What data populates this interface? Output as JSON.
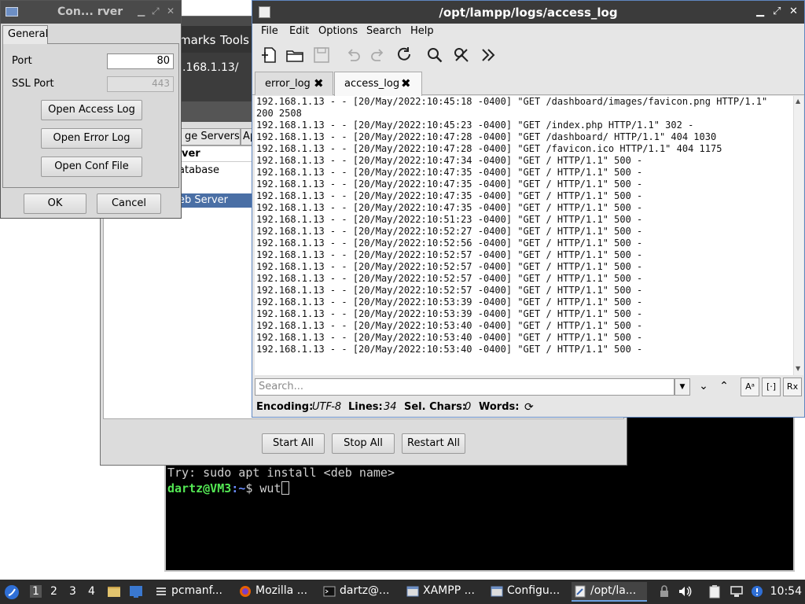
{
  "terminal": {
    "try_line": "Try: sudo apt install <deb name>",
    "prompt_user": "dartz@VM3",
    "prompt_path": ":~",
    "prompt_symbol": "$ ",
    "command": "wut"
  },
  "xampp": {
    "menu": [
      "marks",
      "Tools"
    ],
    "ip_fragment": ".168.1.13/",
    "tabs": [
      "ge Servers",
      "Ap"
    ],
    "list_header": "ver",
    "rows": [
      "atabase",
      "eb Server"
    ],
    "buttons": {
      "start_all": "Start All",
      "stop_all": "Stop All",
      "restart_all": "Restart All"
    }
  },
  "config_dialog": {
    "title": "Con... rver",
    "tab": "General",
    "port_label": "Port",
    "port_value": "80",
    "ssl_port_label": "SSL Port",
    "ssl_port_value": "443",
    "open_access_log": "Open Access Log",
    "open_error_log": "Open Error Log",
    "open_conf_file": "Open Conf File",
    "ok": "OK",
    "cancel": "Cancel"
  },
  "editor": {
    "title": "/opt/lampp/logs/access_log",
    "menu": [
      "File",
      "Edit",
      "Options",
      "Search",
      "Help"
    ],
    "tabs": [
      {
        "label": "error_log",
        "active": false
      },
      {
        "label": "access_log",
        "active": true
      }
    ],
    "lines": [
      "192.168.1.13 - - [20/May/2022:10:45:18 -0400] \"GET /dashboard/images/favicon.png HTTP/1.1\"",
      "200 2508",
      "192.168.1.13 - - [20/May/2022:10:45:23 -0400] \"GET /index.php HTTP/1.1\" 302 -",
      "192.168.1.13 - - [20/May/2022:10:47:28 -0400] \"GET /dashboard/ HTTP/1.1\" 404 1030",
      "192.168.1.13 - - [20/May/2022:10:47:28 -0400] \"GET /favicon.ico HTTP/1.1\" 404 1175",
      "192.168.1.13 - - [20/May/2022:10:47:34 -0400] \"GET / HTTP/1.1\" 500 -",
      "192.168.1.13 - - [20/May/2022:10:47:35 -0400] \"GET / HTTP/1.1\" 500 -",
      "192.168.1.13 - - [20/May/2022:10:47:35 -0400] \"GET / HTTP/1.1\" 500 -",
      "192.168.1.13 - - [20/May/2022:10:47:35 -0400] \"GET / HTTP/1.1\" 500 -",
      "192.168.1.13 - - [20/May/2022:10:47:35 -0400] \"GET / HTTP/1.1\" 500 -",
      "192.168.1.13 - - [20/May/2022:10:51:23 -0400] \"GET / HTTP/1.1\" 500 -",
      "192.168.1.13 - - [20/May/2022:10:52:27 -0400] \"GET / HTTP/1.1\" 500 -",
      "192.168.1.13 - - [20/May/2022:10:52:56 -0400] \"GET / HTTP/1.1\" 500 -",
      "192.168.1.13 - - [20/May/2022:10:52:57 -0400] \"GET / HTTP/1.1\" 500 -",
      "192.168.1.13 - - [20/May/2022:10:52:57 -0400] \"GET / HTTP/1.1\" 500 -",
      "192.168.1.13 - - [20/May/2022:10:52:57 -0400] \"GET / HTTP/1.1\" 500 -",
      "192.168.1.13 - - [20/May/2022:10:52:57 -0400] \"GET / HTTP/1.1\" 500 -",
      "192.168.1.13 - - [20/May/2022:10:53:39 -0400] \"GET / HTTP/1.1\" 500 -",
      "192.168.1.13 - - [20/May/2022:10:53:39 -0400] \"GET / HTTP/1.1\" 500 -",
      "192.168.1.13 - - [20/May/2022:10:53:40 -0400] \"GET / HTTP/1.1\" 500 -",
      "192.168.1.13 - - [20/May/2022:10:53:40 -0400] \"GET / HTTP/1.1\" 500 -",
      "192.168.1.13 - - [20/May/2022:10:53:40 -0400] \"GET / HTTP/1.1\" 500 -"
    ],
    "search_placeholder": "Search...",
    "status": {
      "encoding_label": "Encoding:",
      "encoding_value": "UTF-8",
      "lines_label": "Lines:",
      "lines_value": "34",
      "sel_label": "Sel. Chars:",
      "sel_value": "0",
      "words_label": "Words:"
    }
  },
  "taskbar": {
    "workspaces": [
      "1",
      "2",
      "3",
      "4"
    ],
    "tasks": [
      {
        "label": "pcmanf...",
        "icon": "file-manager-icon"
      },
      {
        "label": "Mozilla ...",
        "icon": "firefox-icon"
      },
      {
        "label": "dartz@...",
        "icon": "terminal-icon"
      },
      {
        "label": "XAMPP ...",
        "icon": "window-icon"
      },
      {
        "label": "Configu...",
        "icon": "window-icon"
      },
      {
        "label": "/opt/la...",
        "icon": "text-editor-icon"
      }
    ],
    "clock": "10:54"
  }
}
